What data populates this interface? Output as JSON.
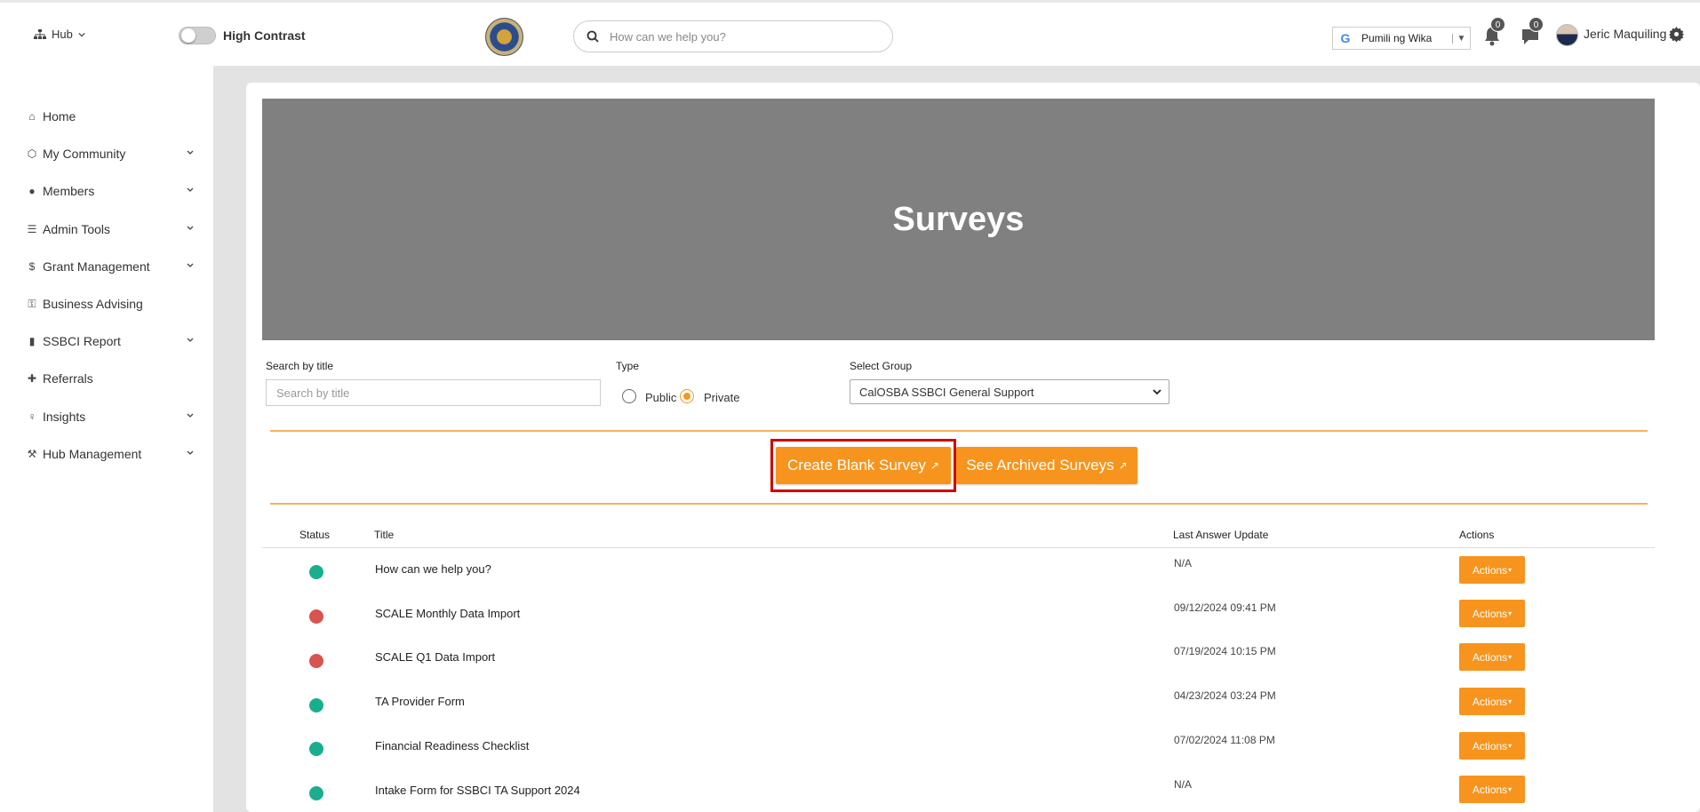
{
  "topbar": {
    "hub_label": "Hub",
    "high_contrast_label": "High Contrast",
    "search_placeholder": "How can we help you?",
    "language_label": "Pumili ng Wika",
    "notifications_count": "0",
    "messages_count": "0",
    "user_name": "Jeric Maquiling"
  },
  "sidebar": {
    "items": [
      {
        "label": "Home",
        "icon": "home-icon",
        "expandable": false
      },
      {
        "label": "My Community",
        "icon": "community-icon",
        "expandable": true
      },
      {
        "label": "Members",
        "icon": "user-circle-icon",
        "expandable": true
      },
      {
        "label": "Admin Tools",
        "icon": "admin-tools-icon",
        "expandable": true
      },
      {
        "label": "Grant Management",
        "icon": "dollar-icon",
        "expandable": true
      },
      {
        "label": "Business Advising",
        "icon": "key-icon",
        "expandable": false
      },
      {
        "label": "SSBCI Report",
        "icon": "file-icon",
        "expandable": true
      },
      {
        "label": "Referrals",
        "icon": "user-plus-icon",
        "expandable": false
      },
      {
        "label": "Insights",
        "icon": "lightbulb-icon",
        "expandable": true
      },
      {
        "label": "Hub Management",
        "icon": "wrench-icon",
        "expandable": true
      }
    ]
  },
  "page": {
    "title": "Surveys"
  },
  "filters": {
    "search_label": "Search by title",
    "search_placeholder": "Search by title",
    "type_label": "Type",
    "type_options": [
      "Public",
      "Private"
    ],
    "type_selected": "Private",
    "group_label": "Select Group",
    "group_selected": "CalOSBA SSBCI General Support"
  },
  "buttons": {
    "create_blank": "Create Blank Survey",
    "see_archived": "See Archived Surveys",
    "external_glyph": "↗"
  },
  "table": {
    "headers": [
      "Status",
      "Title",
      "Last Answer Update",
      "Actions"
    ],
    "action_label": "Actions",
    "rows": [
      {
        "status": "active",
        "status_color": "#1aae8c",
        "title": "How can we help you?",
        "last_update": "N/A"
      },
      {
        "status": "inactive",
        "status_color": "#d9534f",
        "title": "SCALE Monthly Data Import",
        "last_update": "09/12/2024 09:41 PM"
      },
      {
        "status": "inactive",
        "status_color": "#d9534f",
        "title": "SCALE Q1 Data Import",
        "last_update": "07/19/2024 10:15 PM"
      },
      {
        "status": "active",
        "status_color": "#1aae8c",
        "title": "TA Provider Form",
        "last_update": "04/23/2024 03:24 PM"
      },
      {
        "status": "active",
        "status_color": "#1aae8c",
        "title": "Financial Readiness Checklist",
        "last_update": "07/02/2024 11:08 PM"
      },
      {
        "status": "active",
        "status_color": "#1aae8c",
        "title": "Intake Form for SSBCI TA Support 2024",
        "last_update": "N/A"
      }
    ]
  },
  "colors": {
    "accent": "#f7941d",
    "banner_bg": "#808080",
    "active_status": "#1aae8c",
    "inactive_status": "#d9534f",
    "highlight": "#d00000"
  }
}
